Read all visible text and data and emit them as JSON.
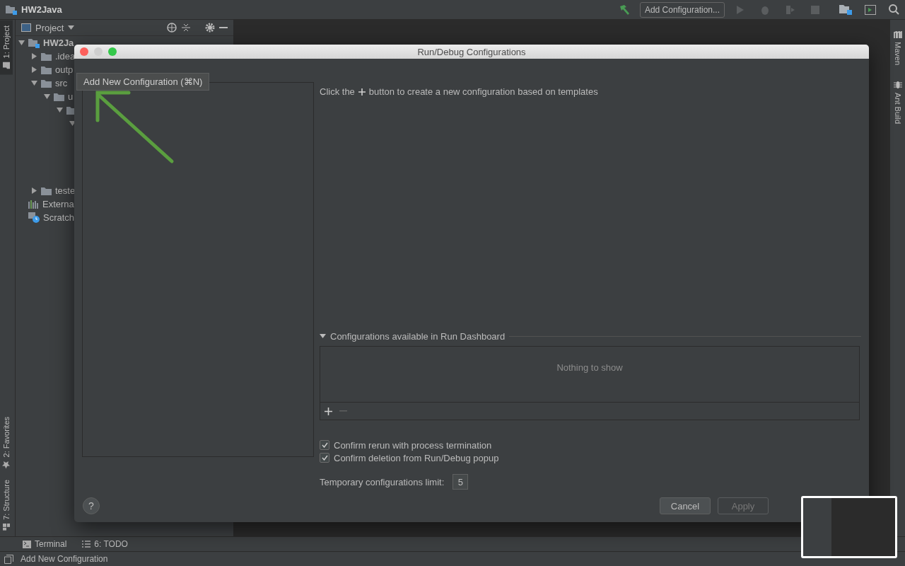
{
  "window": {
    "title": "HW2Java"
  },
  "toolbar": {
    "config_button": "Add Configuration..."
  },
  "left_tool_tabs": [
    {
      "label": "1: Project",
      "selected": true
    },
    {
      "label": "2: Favorites",
      "selected": false
    },
    {
      "label": "7: Structure",
      "selected": false
    }
  ],
  "right_tool_tabs": [
    {
      "label": "Maven",
      "kind": "maven"
    },
    {
      "label": "Ant Build",
      "kind": "ant"
    }
  ],
  "project_panel": {
    "title": "Project",
    "tree": [
      {
        "label": "HW2Ja",
        "kind": "module",
        "expanded": true,
        "children": [
          {
            "label": ".idea",
            "kind": "folder",
            "expanded": false
          },
          {
            "label": "outp",
            "kind": "folder",
            "expanded": false
          },
          {
            "label": "src",
            "kind": "folder",
            "expanded": true,
            "children": [
              {
                "label": "u",
                "kind": "folder",
                "expanded": true,
                "children": [
                  {
                    "kind": "folder",
                    "expanded": true,
                    "children": [
                      {
                        "expanded": true
                      }
                    ]
                  }
                ]
              }
            ]
          },
          {
            "label": "teste",
            "kind": "folder",
            "expanded": false
          }
        ]
      },
      {
        "label": "Externa",
        "kind": "library"
      },
      {
        "label": "Scratch",
        "kind": "scratch"
      }
    ]
  },
  "bottom_tool_tabs": [
    {
      "label": "Terminal",
      "kind": "terminal"
    },
    {
      "label": "6: TODO",
      "kind": "todo"
    }
  ],
  "status_bar": "Add New Configuration",
  "dialog": {
    "title": "Run/Debug Configurations",
    "tooltip": "Add New Configuration (⌘N)",
    "hint_before": "Click the",
    "hint_after": "button to create a new configuration based on templates",
    "dashboard_section": {
      "title": "Configurations available in Run Dashboard",
      "expanded": true,
      "empty_text": "Nothing to show"
    },
    "options": [
      {
        "label": "Confirm rerun with process termination",
        "checked": true
      },
      {
        "label": "Confirm deletion from Run/Debug popup",
        "checked": true
      }
    ],
    "help_button": "?",
    "limit_label": "Temporary configurations limit:",
    "limit_value": "5",
    "buttons": [
      {
        "label": "Cancel",
        "disabled": false
      },
      {
        "label": "Apply",
        "disabled": true
      }
    ]
  }
}
